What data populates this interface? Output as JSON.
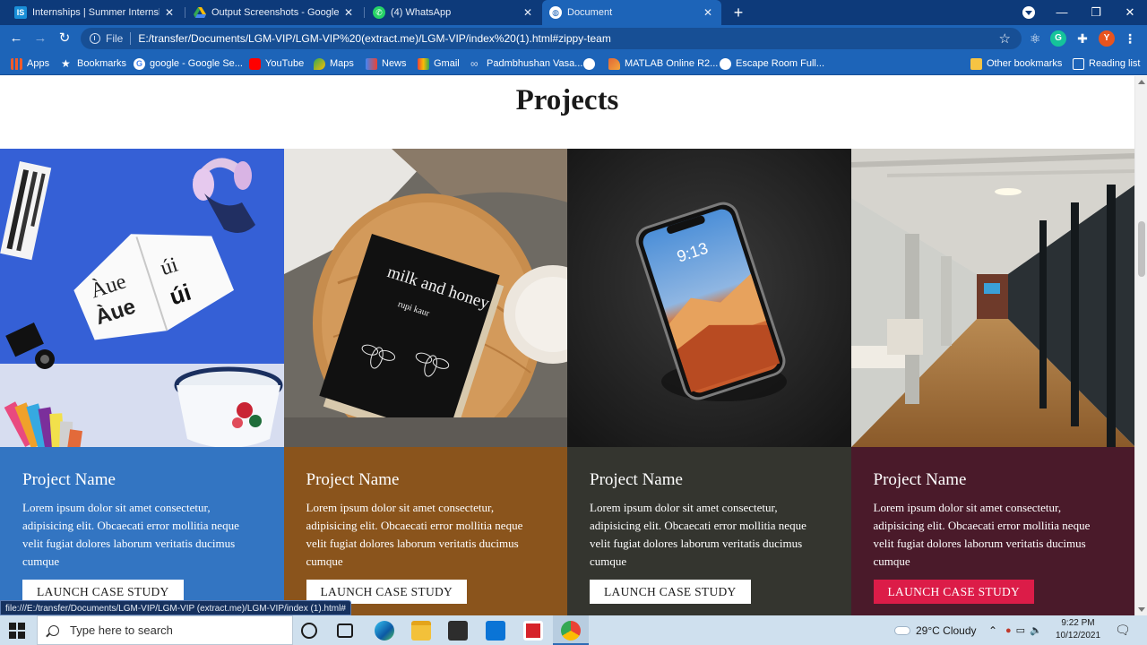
{
  "browser": {
    "tabs": [
      {
        "title": "Internships | Summer Internship",
        "icon": "internshala-icon",
        "favicon_text": "IS",
        "active": false
      },
      {
        "title": "Output Screenshots - Google Dri",
        "icon": "google-drive-icon",
        "active": false
      },
      {
        "title": "(4) WhatsApp",
        "icon": "whatsapp-icon",
        "active": false
      },
      {
        "title": "Document",
        "icon": "globe-icon",
        "active": true
      }
    ],
    "new_tab_label": "+",
    "address": {
      "scheme_label": "File",
      "url": "E:/transfer/Documents/LGM-VIP/LGM-VIP%20(extract.me)/LGM-VIP/index%20(1).html#zippy-team"
    },
    "profile_initial": "Y",
    "extension_g_label": "G",
    "bookmarks": [
      {
        "label": "Apps",
        "icon": "apps-grid-icon"
      },
      {
        "label": "Bookmarks",
        "icon": "star-icon"
      },
      {
        "label": "google - Google Se...",
        "icon": "google-icon"
      },
      {
        "label": "YouTube",
        "icon": "youtube-icon"
      },
      {
        "label": "Maps",
        "icon": "maps-icon"
      },
      {
        "label": "News",
        "icon": "news-icon"
      },
      {
        "label": "Gmail",
        "icon": "gmail-icon"
      },
      {
        "label": "Padmbhushan Vasa...",
        "icon": "link-icon"
      },
      {
        "label": "",
        "icon": "globe-icon"
      },
      {
        "label": "MATLAB Online R2...",
        "icon": "matlab-icon"
      },
      {
        "label": "Escape Room Full...",
        "icon": "globe-icon"
      },
      {
        "label": "Other bookmarks",
        "icon": "folder-icon"
      },
      {
        "label": "Reading list",
        "icon": "reading-list-icon"
      }
    ]
  },
  "page": {
    "heading": "Projects",
    "projects": [
      {
        "name": "Project Name",
        "description": "Lorem ipsum dolor sit amet consectetur, adipisicing elit. Obcaecati error mollitia neque velit fugiat dolores laborum veritatis ducimus cumque",
        "button": "LAUNCH CASE STUDY",
        "bg_color": "#3375c2",
        "button_style": "white",
        "photo": "typography-book-and-headphones"
      },
      {
        "name": "Project Name",
        "description": "Lorem ipsum dolor sit amet consectetur, adipisicing elit. Obcaecati error mollitia neque velit fugiat dolores laborum veritatis ducimus cumque",
        "button": "LAUNCH CASE STUDY",
        "bg_color": "#8a541c",
        "button_style": "white",
        "photo": "milk-and-honey-book-on-table"
      },
      {
        "name": "Project Name",
        "description": "Lorem ipsum dolor sit amet consectetur, adipisicing elit. Obcaecati error mollitia neque velit fugiat dolores laborum veritatis ducimus cumque",
        "button": "LAUNCH CASE STUDY",
        "bg_color": "#34352f",
        "button_style": "white",
        "photo": "smartphone-on-dark-background"
      },
      {
        "name": "Project Name",
        "description": "Lorem ipsum dolor sit amet consectetur, adipisicing elit. Obcaecati error mollitia neque velit fugiat dolores laborum veritatis ducimus cumque",
        "button": "LAUNCH CASE STUDY",
        "bg_color": "#4a1a2a",
        "button_style": "accent",
        "photo": "office-corridor"
      }
    ],
    "book_title_text": "milk and honey",
    "book_author_text": "rupi kaur",
    "phone_time_text": "9:13"
  },
  "status_bar_url": "file:///E:/transfer/Documents/LGM-VIP/LGM-VIP (extract.me)/LGM-VIP/index (1).html#",
  "taskbar": {
    "search_placeholder": "Type here to search",
    "weather": "29°C  Cloudy",
    "time": "9:22 PM",
    "date": "10/12/2021"
  },
  "colors": {
    "tabstrip": "#0d3a7a",
    "toolbar": "#1d64b8",
    "accent_button": "#dc1c48"
  }
}
